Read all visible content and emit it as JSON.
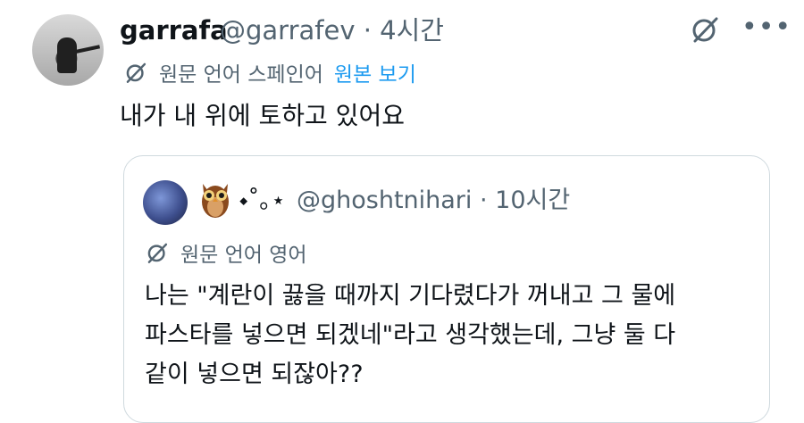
{
  "tweet": {
    "display_name": "garrafa",
    "handle_time": "@garrafev · 4시간",
    "translation_label": "원문 언어 스페인어",
    "view_original": "원본 보기",
    "text": "내가 내 위에 토하고 있어요",
    "icons": [
      "grok-icon",
      "more-icon",
      "translate-icon"
    ]
  },
  "quote": {
    "emoji": "🦉",
    "display_name_symbols": "⬩˚｡⋆",
    "handle_time": "@ghoshtnihari · 10시간",
    "translation_label": "원문 언어 영어",
    "lines": [
      "나는 \"계란이 끓을 때까지 기다렸다가 꺼내고 그 물에",
      "파스타를 넣으면 되겠네\"라고 생각했는데, 그냥 둘 다",
      "같이 넣으면 되잖아??"
    ]
  },
  "colors": {
    "primary_text": "#0f1419",
    "secondary_text": "#536471",
    "link": "#1d9bf0",
    "border": "#cfd9de"
  }
}
